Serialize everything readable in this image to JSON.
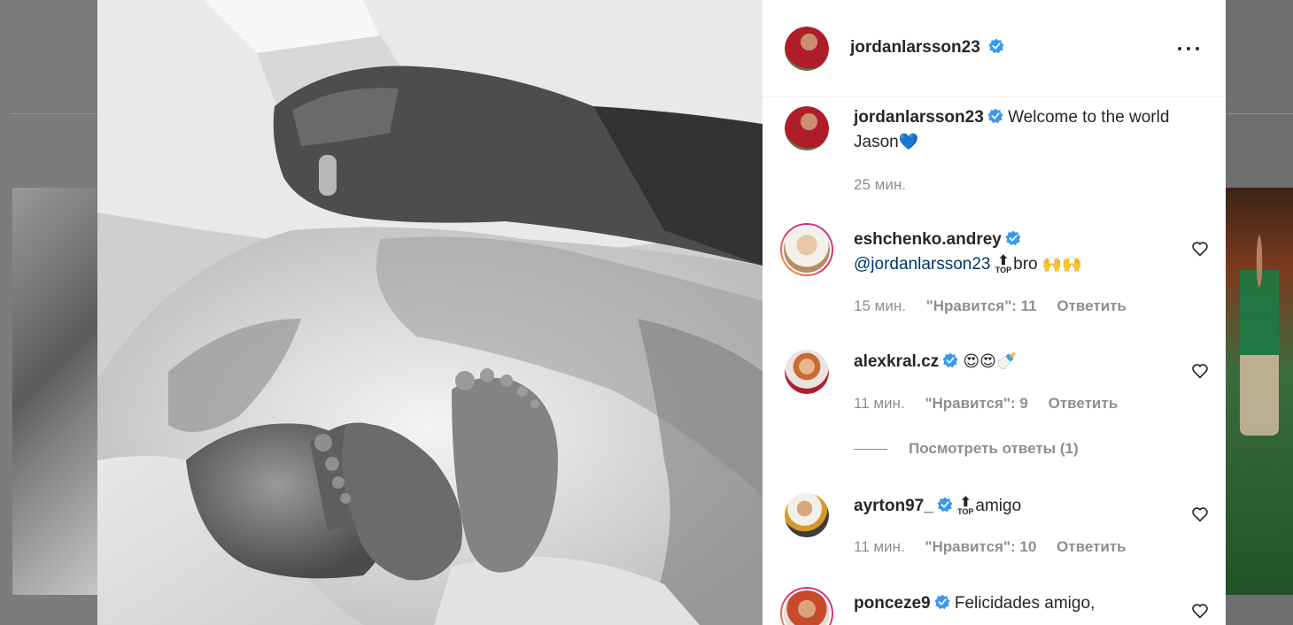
{
  "post": {
    "author": "jordanlarsson23",
    "caption": "Welcome to the world Jason",
    "caption_emoji": "💙",
    "caption_time": "25 мин."
  },
  "comments": [
    {
      "username": "eshchenko.andrey",
      "mention": "@jordanlarsson23",
      "top_label": "TOP",
      "text": "bro",
      "emoji": "🙌🙌",
      "time": "15 мин.",
      "likes": "\"Нравится\": 11",
      "reply": "Ответить"
    },
    {
      "username": "alexkral.cz",
      "emoji": "😍😍🍼",
      "time": "11 мин.",
      "likes": "\"Нравится\": 9",
      "reply": "Ответить",
      "view_replies": "Посмотреть ответы (1)"
    },
    {
      "username": "ayrton97_",
      "top_label": "TOP",
      "text": "amigo",
      "time": "11 мин.",
      "likes": "\"Нравится\": 10",
      "reply": "Ответить"
    },
    {
      "username": "ponceze9",
      "text": "Felicidades amigo,"
    }
  ],
  "icons": {
    "verified": "verified-badge-icon",
    "more": "more-options-icon",
    "like": "heart-icon"
  },
  "colors": {
    "verified": "#3897f0",
    "username": "#262626",
    "meta": "#8e8e8e",
    "mention": "#00376b"
  }
}
